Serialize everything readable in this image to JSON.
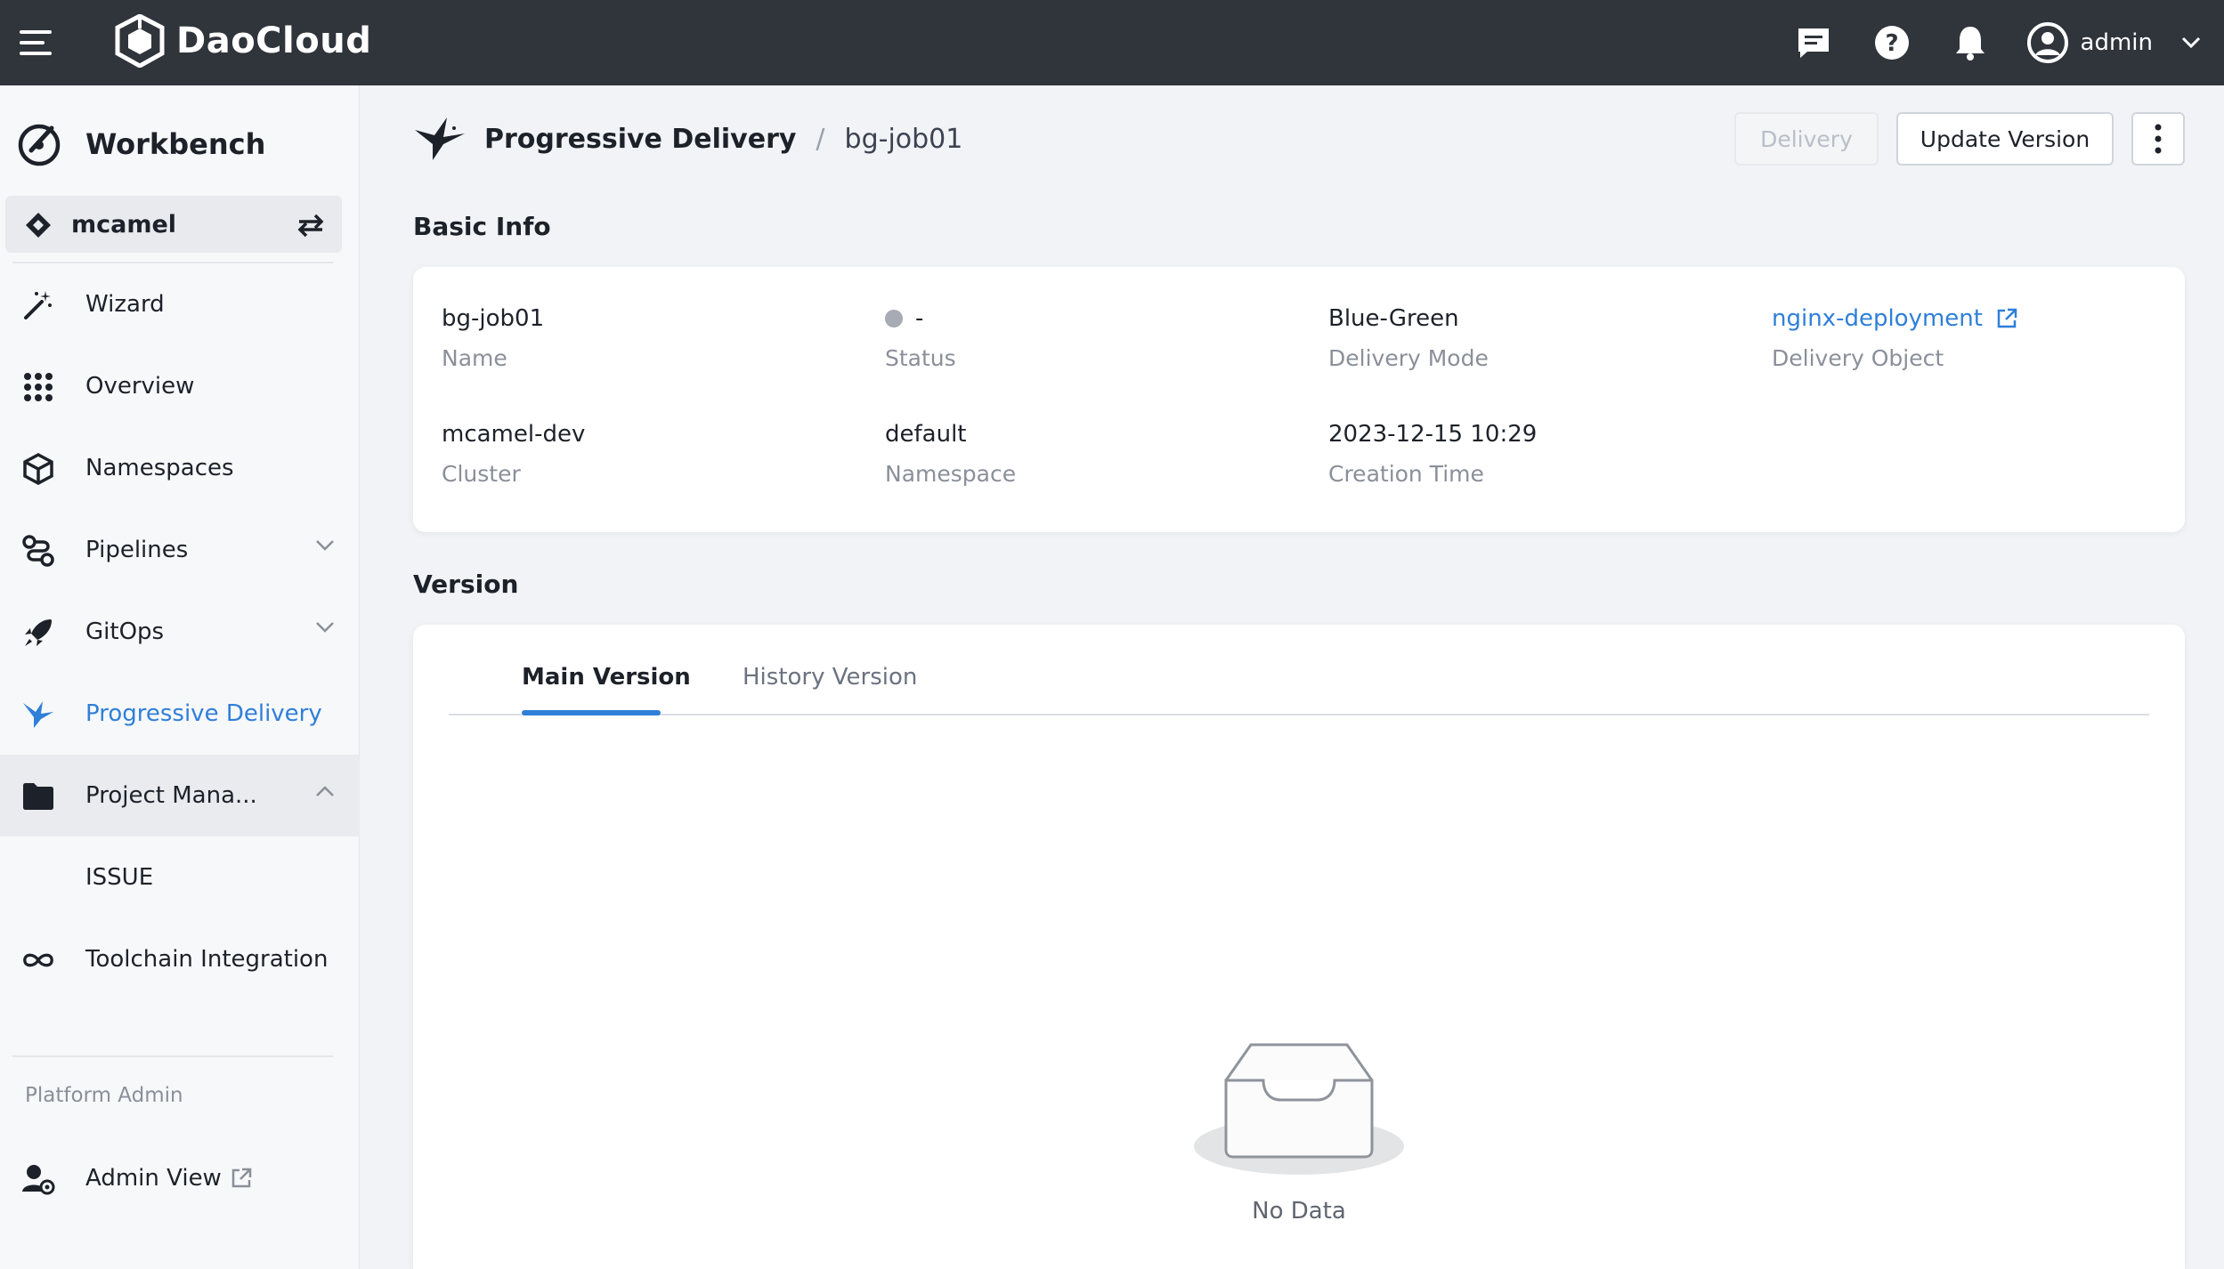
{
  "topbar": {
    "logo_text": "DaoCloud",
    "user_name": "admin",
    "icons": [
      "hamburger-menu-icon",
      "message-icon",
      "help-icon",
      "bell-icon",
      "user-avatar-icon",
      "chevron-down-icon"
    ]
  },
  "sidebar": {
    "title": "Workbench",
    "workspace": "mcamel",
    "items": [
      {
        "label": "Wizard",
        "icon": "magic-wand-icon"
      },
      {
        "label": "Overview",
        "icon": "grid-dots-icon"
      },
      {
        "label": "Namespaces",
        "icon": "cube-icon"
      },
      {
        "label": "Pipelines",
        "icon": "pipeline-icon"
      },
      {
        "label": "GitOps",
        "icon": "rocket-icon"
      },
      {
        "label": "Progressive Delivery",
        "icon": "bird-icon"
      },
      {
        "label": "Project Mana...",
        "icon": "folder-icon"
      },
      {
        "label": "ISSUE",
        "icon": ""
      },
      {
        "label": "Toolchain Integration",
        "icon": "infinity-icon"
      }
    ],
    "group_label": "Platform Admin",
    "admin_view": "Admin View",
    "active_color": "#2f7fd8"
  },
  "breadcrumb": {
    "parent": "Progressive Delivery",
    "separator": "/",
    "current": "bg-job01"
  },
  "actions": {
    "delivery": "Delivery",
    "update_version": "Update Version"
  },
  "basic_info": {
    "title": "Basic Info",
    "fields": [
      {
        "value": "bg-job01",
        "label": "Name"
      },
      {
        "value": "-",
        "label": "Status"
      },
      {
        "value": "Blue-Green",
        "label": "Delivery Mode"
      },
      {
        "value": "nginx-deployment",
        "label": "Delivery Object"
      },
      {
        "value": "mcamel-dev",
        "label": "Cluster"
      },
      {
        "value": "default",
        "label": "Namespace"
      },
      {
        "value": "2023-12-15 10:29",
        "label": "Creation Time"
      }
    ]
  },
  "version": {
    "title": "Version",
    "tabs": [
      "Main Version",
      "History Version"
    ],
    "active_tab": 0,
    "empty_text": "No Data"
  }
}
